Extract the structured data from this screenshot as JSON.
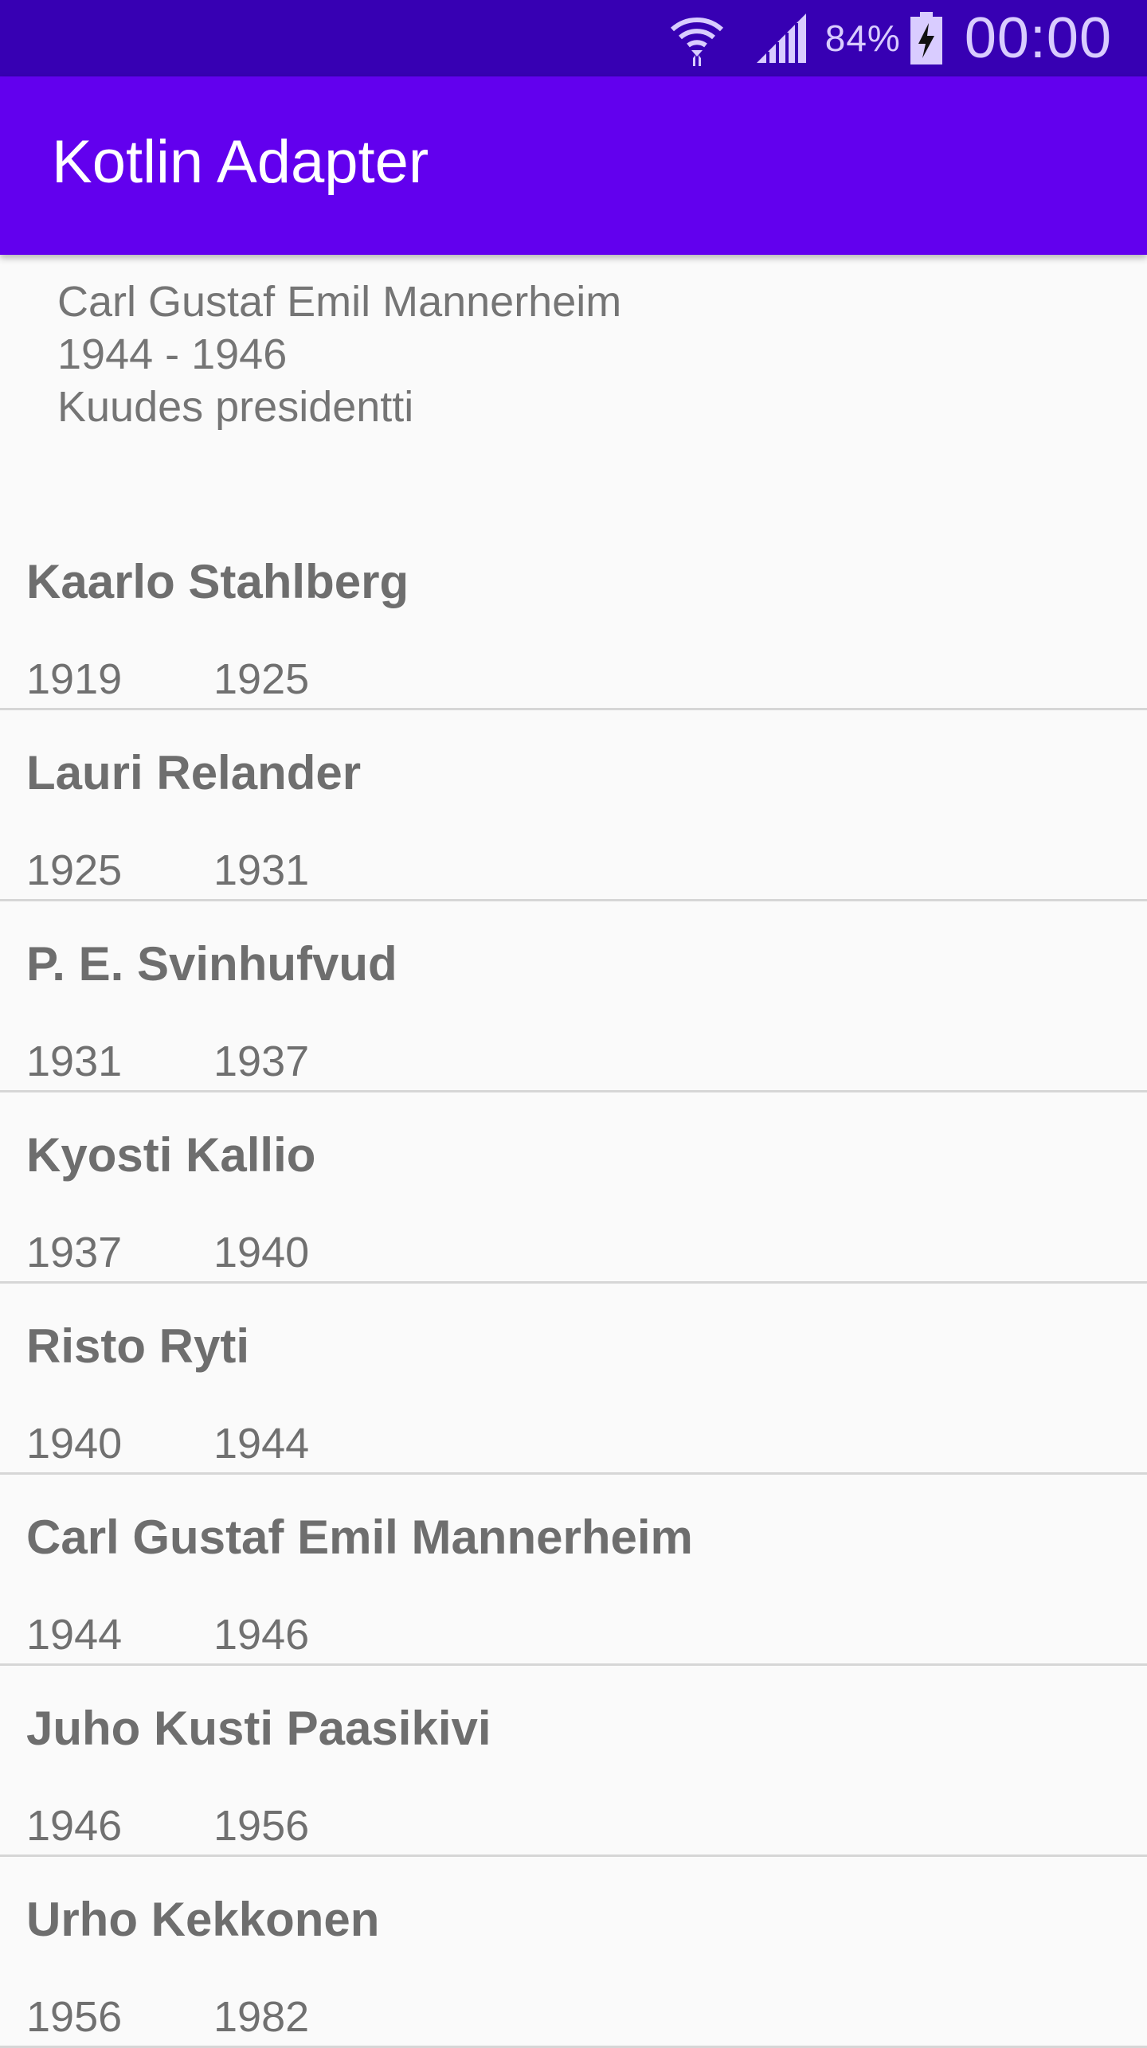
{
  "status_bar": {
    "battery_percent": "84%",
    "time": "00:00",
    "icons": [
      "wifi-icon",
      "cell-signal-icon",
      "battery-charging-icon"
    ],
    "color": "#3700b3"
  },
  "app_bar": {
    "title": "Kotlin Adapter",
    "color": "#6200ee"
  },
  "detail": {
    "name": "Carl Gustaf Emil Mannerheim",
    "years": "1944 - 1946",
    "ordinal": "Kuudes presidentti"
  },
  "presidents": [
    {
      "name": "Kaarlo Stahlberg",
      "start": "1919",
      "end": "1925"
    },
    {
      "name": "Lauri Relander",
      "start": "1925",
      "end": "1931"
    },
    {
      "name": "P. E. Svinhufvud",
      "start": "1931",
      "end": "1937"
    },
    {
      "name": "Kyosti Kallio",
      "start": "1937",
      "end": "1940"
    },
    {
      "name": "Risto Ryti",
      "start": "1940",
      "end": "1944"
    },
    {
      "name": "Carl Gustaf Emil Mannerheim",
      "start": "1944",
      "end": "1946"
    },
    {
      "name": "Juho Kusti Paasikivi",
      "start": "1946",
      "end": "1956"
    },
    {
      "name": "Urho Kekkonen",
      "start": "1956",
      "end": "1982"
    }
  ]
}
